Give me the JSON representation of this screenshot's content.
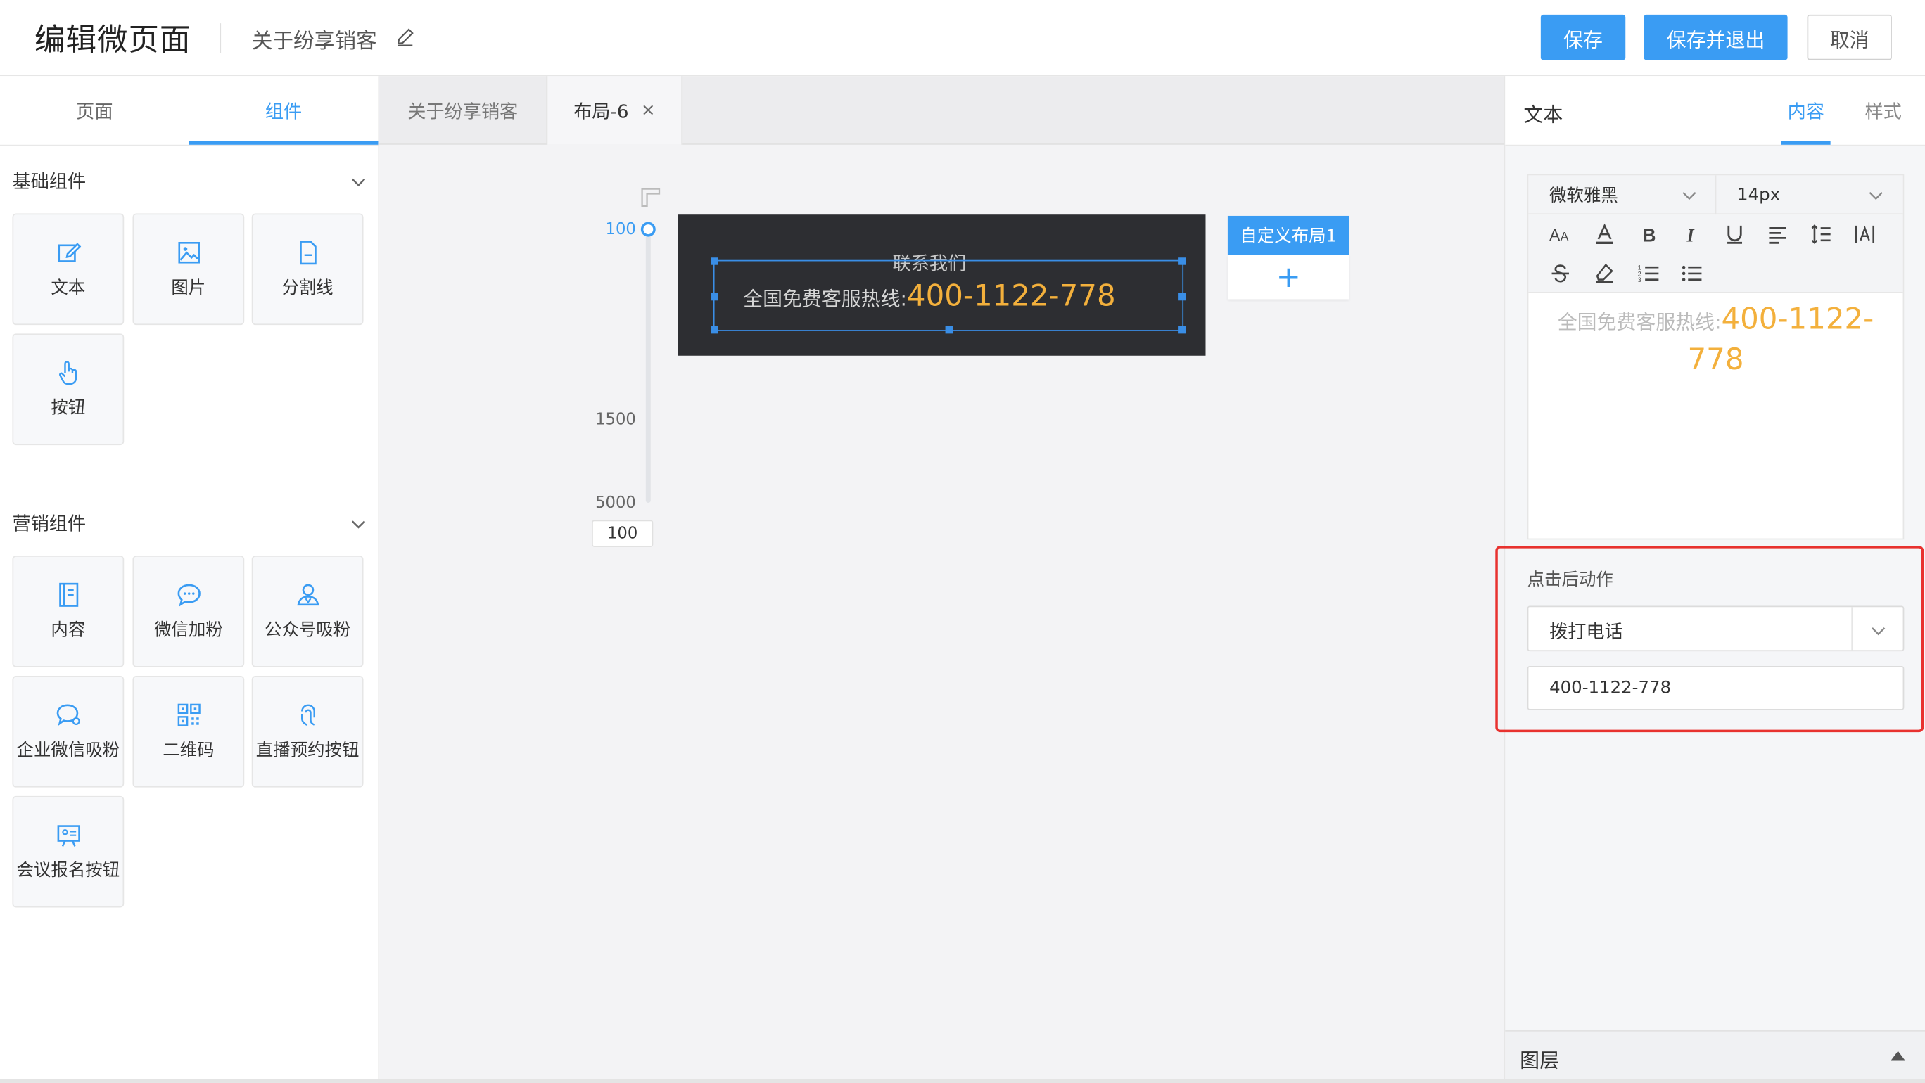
{
  "header": {
    "title": "编辑微页面",
    "doc_name": "关于纷享销客",
    "edit_icon": "pencil-icon",
    "save_label": "保存",
    "save_exit_label": "保存并退出",
    "cancel_label": "取消",
    "accent": "#3a9cf3"
  },
  "left_panel": {
    "tabs": [
      {
        "label": "页面"
      },
      {
        "label": "组件"
      }
    ],
    "active_tab": "组件",
    "sections": [
      {
        "title": "基础组件",
        "items": [
          {
            "label": "文本",
            "icon": "edit-icon"
          },
          {
            "label": "图片",
            "icon": "image-icon"
          },
          {
            "label": "分割线",
            "icon": "document-icon"
          },
          {
            "label": "按钮",
            "icon": "pointer-hand-icon"
          }
        ]
      },
      {
        "title": "营销组件",
        "items": [
          {
            "label": "内容",
            "icon": "book-icon"
          },
          {
            "label": "微信加粉",
            "icon": "chat-bubble-icon"
          },
          {
            "label": "公众号吸粉",
            "icon": "user-icon"
          },
          {
            "label": "企业微信吸粉",
            "icon": "speech-bubble-icon"
          },
          {
            "label": "二维码",
            "icon": "qrcode-icon"
          },
          {
            "label": "直播预约按钮",
            "icon": "fingerprint-icon"
          },
          {
            "label": "会议报名按钮",
            "icon": "presentation-icon"
          }
        ]
      }
    ]
  },
  "canvas": {
    "tabs": [
      {
        "label": "关于纷享销客"
      },
      {
        "label": "布局-6"
      }
    ],
    "active_tab": "布局-6",
    "slider": {
      "top_label": "100",
      "labels": [
        "1500",
        "5000"
      ],
      "value": "100"
    },
    "block": {
      "title": "联系我们",
      "hotline_label": "全国免费客服热线:",
      "hotline_number": "400-1122-778"
    },
    "layout_tag": "自定义布局1",
    "add_symbol": "+"
  },
  "right_panel": {
    "title": "文本",
    "tabs": [
      {
        "label": "内容"
      },
      {
        "label": "样式"
      }
    ],
    "active_tab": "内容",
    "font_family": "微软雅黑",
    "font_size": "14px",
    "toolbar_row1": [
      "font-size-icon",
      "font-color-icon",
      "bold-icon",
      "italic-icon",
      "underline-icon",
      "align-left-icon",
      "line-height-icon",
      "letter-spacing-icon"
    ],
    "toolbar_row2": [
      "strikethrough-icon",
      "highlight-icon",
      "ordered-list-icon",
      "unordered-list-icon"
    ],
    "editor_text_label": "全国免费客服热线:",
    "editor_text_number": "400-1122-778",
    "action": {
      "title": "点击后动作",
      "selected": "拨打电话",
      "value": "400-1122-778",
      "highlight_color": "#e8322f"
    },
    "layers_label": "图层"
  }
}
